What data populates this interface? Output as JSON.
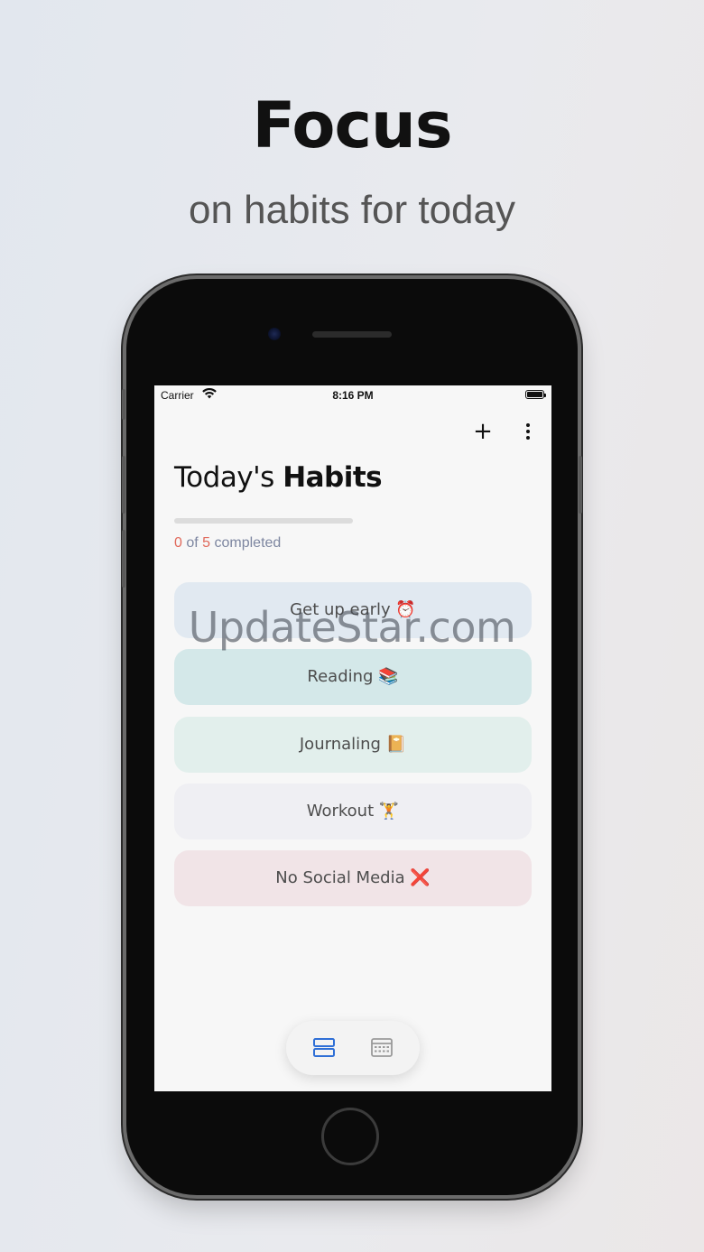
{
  "promo": {
    "headline": "Focus",
    "subline": "on habits for today"
  },
  "status_bar": {
    "carrier": "Carrier",
    "time": "8:16 PM",
    "icons": [
      "wifi-icon",
      "battery-icon"
    ]
  },
  "toolbar": {
    "add_label": "+",
    "icons": [
      "plus-icon",
      "more-vertical-icon"
    ]
  },
  "header": {
    "title_prefix": "Today's ",
    "title_bold": "Habits"
  },
  "progress": {
    "completed": "0",
    "of_label": " of ",
    "total": "5",
    "suffix": " completed",
    "fraction": 0
  },
  "habits": [
    {
      "label": "Get up early ⏰",
      "color": "#e1e9f1"
    },
    {
      "label": "Reading 📚",
      "color": "#d4e8e9"
    },
    {
      "label": "Journaling 📔",
      "color": "#e2efec"
    },
    {
      "label": "Workout 🏋️",
      "color": "#efeff3"
    },
    {
      "label": "No Social Media ❌",
      "color": "#f1e4e7"
    }
  ],
  "tabbar": {
    "items": [
      "list-view-icon",
      "calendar-icon"
    ],
    "active_color": "#2f6fd6",
    "inactive_color": "#9a9a9a"
  },
  "watermark": "UpdateStar.com",
  "colors": {
    "accent": "#e0685a",
    "muted_text": "#7d86a0"
  }
}
